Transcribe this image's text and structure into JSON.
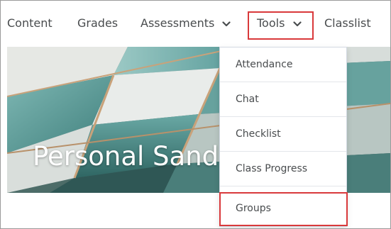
{
  "nav": {
    "items": [
      {
        "label": "Content"
      },
      {
        "label": "Grades"
      },
      {
        "label": "Assessments"
      },
      {
        "label": "Tools"
      },
      {
        "label": "Classlist"
      }
    ]
  },
  "banner": {
    "title": "Personal Sand"
  },
  "tools_menu": {
    "items": [
      {
        "label": "Attendance"
      },
      {
        "label": "Chat"
      },
      {
        "label": "Checklist"
      },
      {
        "label": "Class Progress"
      },
      {
        "label": "Groups"
      }
    ]
  },
  "colors": {
    "highlight": "#d9393b",
    "nav_text": "#494c4e",
    "banner_teal": "#5a9c9a"
  },
  "icons": [
    "chevron-down-icon"
  ]
}
